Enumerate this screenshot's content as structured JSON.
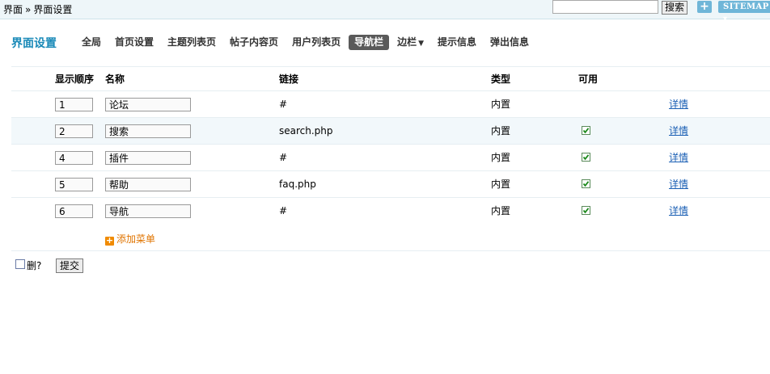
{
  "breadcrumb": {
    "root": "界面",
    "separator": "»",
    "current": "界面设置"
  },
  "header": {
    "search_value": "",
    "search_button": "搜索",
    "plus_label": "+",
    "sitemap_label": "SITEMAP"
  },
  "page_title": "界面设置",
  "tabs": [
    {
      "label": "全局"
    },
    {
      "label": "首页设置"
    },
    {
      "label": "主题列表页"
    },
    {
      "label": "帖子内容页"
    },
    {
      "label": "用户列表页"
    },
    {
      "label": "导航栏",
      "active": true
    },
    {
      "label": "边栏"
    },
    {
      "label": "提示信息"
    },
    {
      "label": "弹出信息"
    }
  ],
  "table": {
    "columns": {
      "order": "显示顺序",
      "name": "名称",
      "link": "链接",
      "type": "类型",
      "enabled": "可用"
    },
    "rows": [
      {
        "order": "1",
        "name": "论坛",
        "link": "#",
        "type": "内置",
        "enabled": false,
        "detail": "详情"
      },
      {
        "order": "2",
        "name": "搜索",
        "link": "search.php",
        "type": "内置",
        "enabled": true,
        "detail": "详情"
      },
      {
        "order": "4",
        "name": "插件",
        "link": "#",
        "type": "内置",
        "enabled": true,
        "detail": "详情"
      },
      {
        "order": "5",
        "name": "帮助",
        "link": "faq.php",
        "type": "内置",
        "enabled": true,
        "detail": "详情"
      },
      {
        "order": "6",
        "name": "导航",
        "link": "#",
        "type": "内置",
        "enabled": true,
        "detail": "详情"
      }
    ]
  },
  "add_menu_label": "添加菜单",
  "footer": {
    "delete_label": "删?",
    "submit_label": "提交"
  },
  "colors": {
    "accent": "#1a8ab8",
    "link": "#1a5fb4",
    "add": "#e07400",
    "active_tab": "#5a5a5a"
  }
}
